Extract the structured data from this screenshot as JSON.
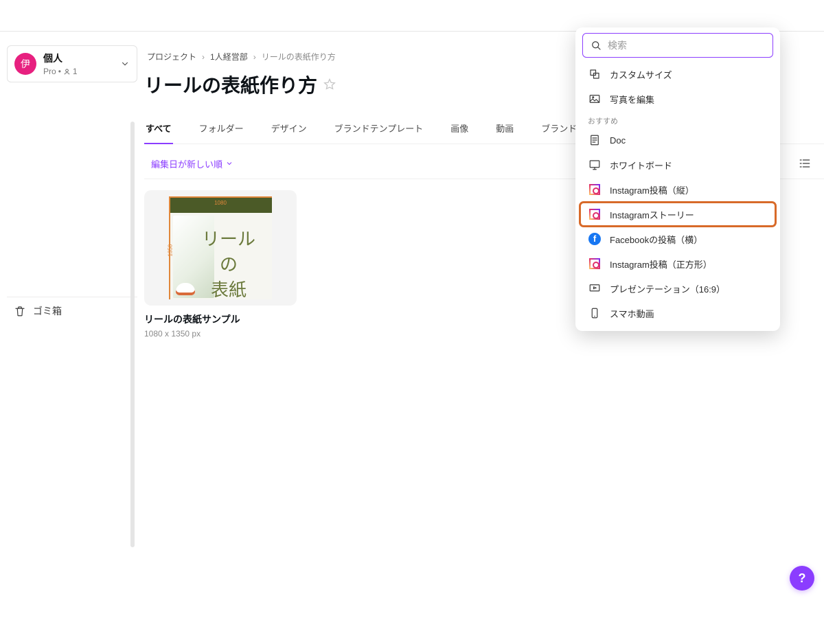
{
  "account": {
    "avatar_char": "伊",
    "name": "個人",
    "plan": "Pro",
    "members": "1"
  },
  "trash_label": "ゴミ箱",
  "breadcrumb": {
    "root": "プロジェクト",
    "mid": "1人経営部",
    "cur": "リールの表紙作り方"
  },
  "title": "リールの表紙作り方",
  "tabs": [
    {
      "label": "すべて",
      "active": true
    },
    {
      "label": "フォルダー",
      "active": false
    },
    {
      "label": "デザイン",
      "active": false
    },
    {
      "label": "ブランドテンプレート",
      "active": false
    },
    {
      "label": "画像",
      "active": false
    },
    {
      "label": "動画",
      "active": false
    },
    {
      "label": "ブランドキット",
      "active": false
    }
  ],
  "sort_label": "編集日が新しい順",
  "card": {
    "line1": "リールの",
    "line2": "表紙",
    "dim_w": "1080",
    "dim_h": "1350",
    "title": "リールの表紙サンプル",
    "meta": "1080 x 1350 px"
  },
  "dropdown": {
    "search_placeholder": "検索",
    "custom_size": "カスタムサイズ",
    "edit_photo": "写真を編集",
    "section": "おすすめ",
    "items": [
      {
        "label": "Doc",
        "icon": "doc",
        "highlight": false
      },
      {
        "label": "ホワイトボード",
        "icon": "whiteboard",
        "highlight": false
      },
      {
        "label": "Instagram投稿（縦）",
        "icon": "instagram",
        "highlight": false
      },
      {
        "label": "Instagramストーリー",
        "icon": "instagram",
        "highlight": true
      },
      {
        "label": "Facebookの投稿（横）",
        "icon": "facebook",
        "highlight": false
      },
      {
        "label": "Instagram投稿（正方形）",
        "icon": "instagram",
        "highlight": false
      },
      {
        "label": "プレゼンテーション（16:9）",
        "icon": "presentation",
        "highlight": false
      },
      {
        "label": "スマホ動画",
        "icon": "phone",
        "highlight": false
      }
    ]
  },
  "help": "?"
}
